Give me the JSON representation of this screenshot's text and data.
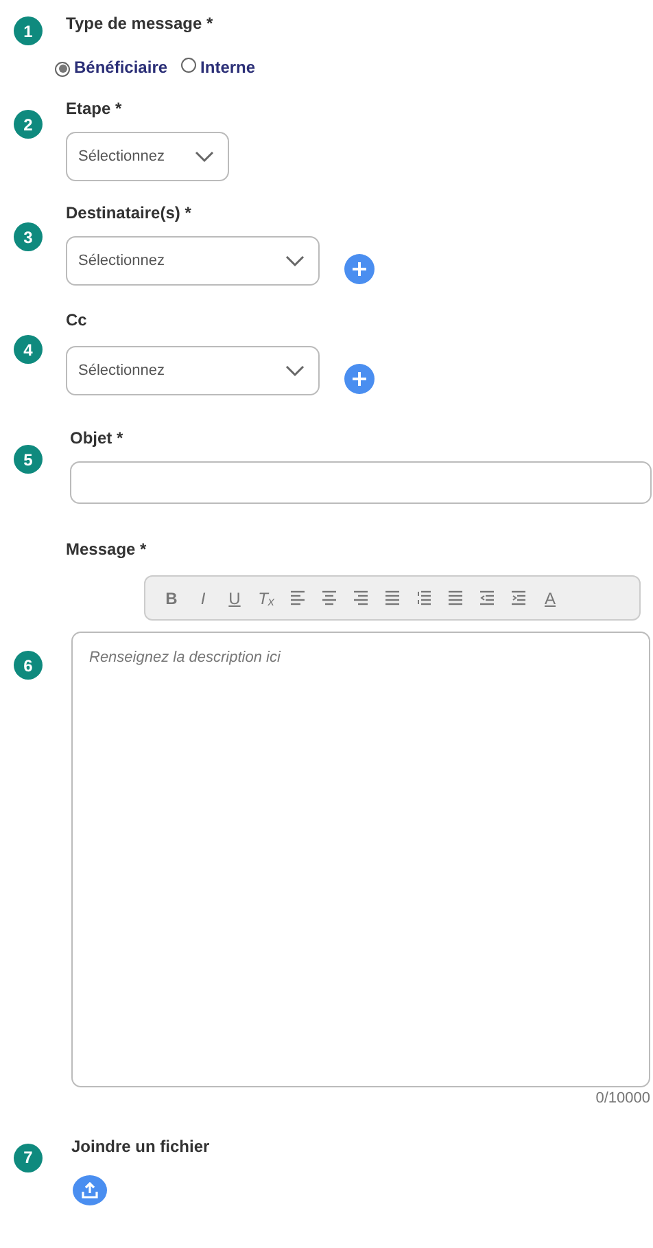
{
  "steps": [
    {
      "number": "1",
      "label": "Type de message *",
      "kind": "radio",
      "options": [
        {
          "label": "Bénéficiaire",
          "selected": true
        },
        {
          "label": "Interne",
          "selected": false
        }
      ]
    },
    {
      "number": "2",
      "label": "Etape *",
      "kind": "select",
      "placeholder": "Sélectionnez"
    },
    {
      "number": "3",
      "label": "Destinataire(s) *",
      "kind": "select",
      "placeholder": "Sélectionnez",
      "add_button": true
    },
    {
      "number": "4",
      "label": "Cc",
      "kind": "select",
      "placeholder": "Sélectionnez",
      "add_button": true
    },
    {
      "number": "5",
      "label": "Objet *",
      "kind": "text"
    },
    {
      "number": "6",
      "label": "Message *",
      "kind": "editor",
      "placeholder": "Renseignez la description ici",
      "counter": "0/10000",
      "toolbar": [
        {
          "kind": "bold",
          "label": "B"
        },
        {
          "kind": "italic",
          "label": "I"
        },
        {
          "kind": "underline",
          "label": "U"
        },
        {
          "kind": "clear-format",
          "label": "T$_{x}$"
        },
        {
          "kind": "align-left"
        },
        {
          "kind": "align-center"
        },
        {
          "kind": "align-right"
        },
        {
          "kind": "justify"
        },
        {
          "kind": "ordered-list"
        },
        {
          "kind": "bullet-list"
        },
        {
          "kind": "outdent"
        },
        {
          "kind": "indent"
        },
        {
          "kind": "text-color",
          "label": "A"
        }
      ]
    },
    {
      "number": "7",
      "label": "Joindre un fichier",
      "kind": "upload"
    }
  ]
}
